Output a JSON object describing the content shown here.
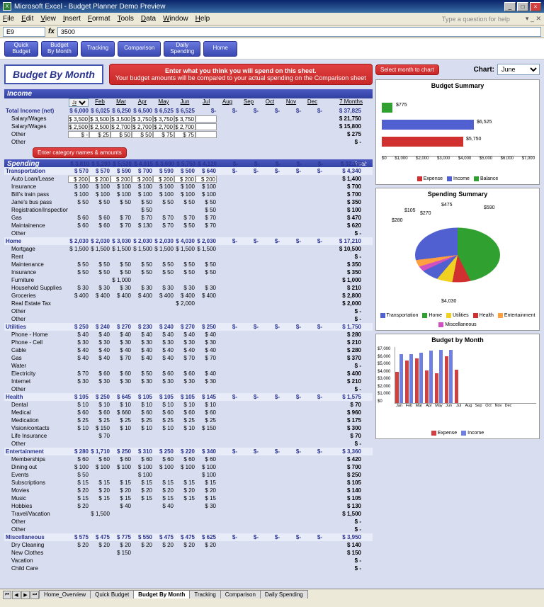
{
  "window": {
    "title": "Microsoft Excel - Budget Planner Demo Preview"
  },
  "menu": {
    "items": [
      "File",
      "Edit",
      "View",
      "Insert",
      "Format",
      "Tools",
      "Data",
      "Window",
      "Help"
    ],
    "help_prompt": "Type a question for help"
  },
  "formula": {
    "cellref": "E9",
    "value": "3500"
  },
  "nav": {
    "buttons": [
      "Quick Budget",
      "Budget By Month",
      "Tracking",
      "Comparison",
      "Daily Spending",
      "Home"
    ]
  },
  "header": {
    "page_title": "Budget By Month",
    "callout_line1": "Enter what you think you will spend on this sheet.",
    "callout_line2": "Your budget amounts will be compared to your actual spending on the Comparison sheet",
    "small_callout1": "Select month to chart",
    "small_callout2": "Enter category names & amounts",
    "chart_label": "Chart:",
    "chart_month": "June"
  },
  "months": [
    "Jan",
    "Feb",
    "Mar",
    "Apr",
    "May",
    "Jun",
    "Jul",
    "Aug",
    "Sep",
    "Oct",
    "Nov",
    "Dec"
  ],
  "total_col": "7 Months",
  "income": {
    "title": "Income",
    "net_label": "Total Income (net)",
    "net_row": [
      "$ 6,000",
      "$ 6,025",
      "$ 6,250",
      "$ 6,500",
      "$ 6,525",
      "$ 6,525",
      "$-",
      "$-",
      "$-",
      "$-",
      "$-",
      "$-"
    ],
    "net_total": "$ 37,825",
    "rows": [
      {
        "name": "Salary/Wages",
        "vals": [
          "$ 3,500",
          "$ 3,500",
          "$ 3,500",
          "$ 3,750",
          "$ 3,750",
          "$ 3,750"
        ],
        "tot": "21,750"
      },
      {
        "name": "Salary/Wages",
        "vals": [
          "$ 2,500",
          "$ 2,500",
          "$ 2,700",
          "$ 2,700",
          "$ 2,700",
          "$ 2,700"
        ],
        "tot": "15,800"
      },
      {
        "name": "Other",
        "vals": [
          "$  -",
          "$ 25",
          "$  50",
          "$  50",
          "$  75",
          "$  75"
        ],
        "tot": "275"
      },
      {
        "name": "Other",
        "vals": [],
        "tot": "-"
      }
    ]
  },
  "spending": {
    "title": "Spending",
    "total_label": "Total:",
    "totals": [
      "$ 3,810",
      "$ 5,280",
      "$ 5,520",
      "$ 4,015",
      "$ 3,690",
      "$ 5,750",
      "$ 4,120",
      "$-",
      "$-",
      "$-",
      "$-",
      "$-"
    ],
    "grand_total": "$ 32,185",
    "categories": [
      {
        "name": "Transportation",
        "totals": [
          "$ 570",
          "$ 570",
          "$ 590",
          "$ 700",
          "$ 590",
          "$ 500",
          "$ 640",
          "$-",
          "$-",
          "$-",
          "$-",
          "$-"
        ],
        "ct": "4,340",
        "rows": [
          {
            "name": "Auto Loan/Lease",
            "vals": [
              "$ 200",
              "$ 200",
              "$ 200",
              "$ 200",
              "$ 200",
              "$ 200",
              "$ 200"
            ],
            "tot": "1,400"
          },
          {
            "name": "Insurance",
            "vals": [
              "$ 100",
              "$ 100",
              "$ 100",
              "$ 100",
              "$ 100",
              "$ 100",
              "$ 100"
            ],
            "tot": "700"
          },
          {
            "name": "Bill's train pass",
            "vals": [
              "$ 100",
              "$ 100",
              "$ 100",
              "$ 100",
              "$ 100",
              "$ 100",
              "$ 100"
            ],
            "tot": "700"
          },
          {
            "name": "Jane's bus pass",
            "vals": [
              "$ 50",
              "$ 50",
              "$ 50",
              "$ 50",
              "$ 50",
              "$ 50",
              "$ 50"
            ],
            "tot": "350"
          },
          {
            "name": "Registration/Inspection",
            "vals": [
              "",
              "",
              "",
              "$ 50",
              "",
              "",
              "$ 50"
            ],
            "tot": "100"
          },
          {
            "name": "Gas",
            "vals": [
              "$ 60",
              "$ 60",
              "$ 70",
              "$ 70",
              "$ 70",
              "$ 70",
              "$ 70"
            ],
            "tot": "470"
          },
          {
            "name": "Maintainence",
            "vals": [
              "$ 60",
              "$ 60",
              "$ 70",
              "$ 130",
              "$ 70",
              "$ 50",
              "$ 70"
            ],
            "tot": "620"
          },
          {
            "name": "Other",
            "vals": [],
            "tot": "-"
          }
        ]
      },
      {
        "name": "Home",
        "totals": [
          "$ 2,030",
          "$ 2,030",
          "$ 3,030",
          "$ 2,030",
          "$ 2,030",
          "$ 4,030",
          "$ 2,030",
          "$-",
          "$-",
          "$-",
          "$-",
          "$-"
        ],
        "ct": "17,210",
        "rows": [
          {
            "name": "Mortgage",
            "vals": [
              "$ 1,500",
              "$ 1,500",
              "$ 1,500",
              "$ 1,500",
              "$ 1,500",
              "$ 1,500",
              "$ 1,500"
            ],
            "tot": "10,500"
          },
          {
            "name": "Rent",
            "vals": [],
            "tot": "-"
          },
          {
            "name": "Maintenance",
            "vals": [
              "$ 50",
              "$ 50",
              "$ 50",
              "$ 50",
              "$ 50",
              "$ 50",
              "$ 50"
            ],
            "tot": "350"
          },
          {
            "name": "Insurance",
            "vals": [
              "$ 50",
              "$ 50",
              "$ 50",
              "$ 50",
              "$ 50",
              "$ 50",
              "$ 50"
            ],
            "tot": "350"
          },
          {
            "name": "Furniture",
            "vals": [
              "",
              "",
              "$ 1,000",
              "",
              "",
              "",
              "",
              ""
            ],
            "tot": "1,000"
          },
          {
            "name": "Household Supplies",
            "vals": [
              "$ 30",
              "$ 30",
              "$ 30",
              "$ 30",
              "$ 30",
              "$ 30",
              "$ 30"
            ],
            "tot": "210"
          },
          {
            "name": "Groceries",
            "vals": [
              "$ 400",
              "$ 400",
              "$ 400",
              "$ 400",
              "$ 400",
              "$ 400",
              "$ 400"
            ],
            "tot": "2,800"
          },
          {
            "name": "Real Estate Tax",
            "vals": [
              "",
              "",
              "",
              "",
              "",
              "$ 2,000",
              ""
            ],
            "tot": "2,000"
          },
          {
            "name": "Other",
            "vals": [],
            "tot": "-"
          },
          {
            "name": "Other",
            "vals": [],
            "tot": "-"
          }
        ]
      },
      {
        "name": "Utilities",
        "totals": [
          "$ 250",
          "$ 240",
          "$ 270",
          "$ 230",
          "$ 240",
          "$ 270",
          "$ 250",
          "$-",
          "$-",
          "$-",
          "$-",
          "$-"
        ],
        "ct": "1,750",
        "rows": [
          {
            "name": "Phone - Home",
            "vals": [
              "$ 40",
              "$ 40",
              "$ 40",
              "$ 40",
              "$ 40",
              "$ 40",
              "$ 40"
            ],
            "tot": "280"
          },
          {
            "name": "Phone - Cell",
            "vals": [
              "$ 30",
              "$ 30",
              "$ 30",
              "$ 30",
              "$ 30",
              "$ 30",
              "$ 30"
            ],
            "tot": "210"
          },
          {
            "name": "Cable",
            "vals": [
              "$ 40",
              "$ 40",
              "$ 40",
              "$ 40",
              "$ 40",
              "$ 40",
              "$ 40"
            ],
            "tot": "280"
          },
          {
            "name": "Gas",
            "vals": [
              "$ 40",
              "$ 40",
              "$ 70",
              "$ 40",
              "$ 40",
              "$ 70",
              "$ 70"
            ],
            "tot": "370"
          },
          {
            "name": "Water",
            "vals": [],
            "tot": "-"
          },
          {
            "name": "Electricity",
            "vals": [
              "$ 70",
              "$ 60",
              "$ 60",
              "$ 50",
              "$ 60",
              "$ 60",
              "$ 40"
            ],
            "tot": "400"
          },
          {
            "name": "Internet",
            "vals": [
              "$ 30",
              "$ 30",
              "$ 30",
              "$ 30",
              "$ 30",
              "$ 30",
              "$ 30"
            ],
            "tot": "210"
          },
          {
            "name": "Other",
            "vals": [],
            "tot": "-"
          }
        ]
      },
      {
        "name": "Health",
        "totals": [
          "$ 105",
          "$ 250",
          "$ 645",
          "$ 105",
          "$ 105",
          "$ 105",
          "$ 145",
          "$-",
          "$-",
          "$-",
          "$-",
          "$-"
        ],
        "ct": "1,575",
        "rows": [
          {
            "name": "Dental",
            "vals": [
              "$ 10",
              "$ 10",
              "$ 10",
              "$ 10",
              "$ 10",
              "$ 10",
              "$ 10"
            ],
            "tot": "70"
          },
          {
            "name": "Medical",
            "vals": [
              "$ 60",
              "$ 60",
              "$ 660",
              "$ 60",
              "$ 60",
              "$ 60",
              "$ 60"
            ],
            "tot": "960"
          },
          {
            "name": "Medication",
            "vals": [
              "$ 25",
              "$ 25",
              "$ 25",
              "$ 25",
              "$ 25",
              "$ 25",
              "$ 25"
            ],
            "tot": "175"
          },
          {
            "name": "Vision/contacts",
            "vals": [
              "$ 10",
              "$ 150",
              "$ 10",
              "$ 10",
              "$ 10",
              "$ 10",
              "$ 150"
            ],
            "tot": "300"
          },
          {
            "name": "Life Insurance",
            "vals": [
              "",
              "$ 70",
              "",
              "",
              "",
              "",
              ""
            ],
            "tot": "70"
          },
          {
            "name": "Other",
            "vals": [],
            "tot": "-"
          }
        ]
      },
      {
        "name": "Entertainment",
        "totals": [
          "$ 280",
          "$ 1,710",
          "$ 250",
          "$ 310",
          "$ 250",
          "$ 220",
          "$ 340",
          "$-",
          "$-",
          "$-",
          "$-",
          "$-"
        ],
        "ct": "3,360",
        "rows": [
          {
            "name": "Memberships",
            "vals": [
              "$ 60",
              "$ 60",
              "$ 60",
              "$ 60",
              "$ 60",
              "$ 60",
              "$ 60"
            ],
            "tot": "420"
          },
          {
            "name": "Dining out",
            "vals": [
              "$ 100",
              "$ 100",
              "$ 100",
              "$ 100",
              "$ 100",
              "$ 100",
              "$ 100"
            ],
            "tot": "700"
          },
          {
            "name": "Events",
            "vals": [
              "$ 50",
              "",
              "",
              "$ 100",
              "",
              "",
              "$ 100"
            ],
            "tot": "250"
          },
          {
            "name": "Subscriptions",
            "vals": [
              "$ 15",
              "$ 15",
              "$ 15",
              "$ 15",
              "$ 15",
              "$ 15",
              "$ 15"
            ],
            "tot": "105"
          },
          {
            "name": "Movies",
            "vals": [
              "$ 20",
              "$ 20",
              "$ 20",
              "$ 20",
              "$ 20",
              "$ 20",
              "$ 20"
            ],
            "tot": "140"
          },
          {
            "name": "Music",
            "vals": [
              "$ 15",
              "$ 15",
              "$ 15",
              "$ 15",
              "$ 15",
              "$ 15",
              "$ 15"
            ],
            "tot": "105"
          },
          {
            "name": "Hobbies",
            "vals": [
              "$ 20",
              "",
              "$ 40",
              "",
              "$ 40",
              "",
              "$ 30"
            ],
            "tot": "130"
          },
          {
            "name": "Travel/Vacation",
            "vals": [
              "",
              "$ 1,500",
              "",
              "",
              "",
              "",
              ""
            ],
            "tot": "1,500"
          },
          {
            "name": "Other",
            "vals": [],
            "tot": "-"
          },
          {
            "name": "Other",
            "vals": [],
            "tot": "-"
          }
        ]
      },
      {
        "name": "Miscellaneous",
        "totals": [
          "$ 575",
          "$ 475",
          "$ 775",
          "$ 550",
          "$ 475",
          "$ 475",
          "$ 625",
          "$-",
          "$-",
          "$-",
          "$-",
          "$-"
        ],
        "ct": "3,950",
        "rows": [
          {
            "name": "Dry Cleaning",
            "vals": [
              "$ 20",
              "$ 20",
              "$ 20",
              "$ 20",
              "$ 20",
              "$ 20",
              "$ 20"
            ],
            "tot": "140"
          },
          {
            "name": "New Clothes",
            "vals": [
              "",
              "",
              "$ 150",
              "",
              "",
              "",
              ""
            ],
            "tot": "150"
          },
          {
            "name": "Vacation",
            "vals": [],
            "tot": "-"
          },
          {
            "name": "Child Care",
            "vals": [],
            "tot": "-"
          }
        ]
      }
    ]
  },
  "charts": {
    "summary": {
      "title": "Budget Summary",
      "labels": [
        "$775",
        "$6,525",
        "$5,750"
      ],
      "axis": [
        "$0",
        "$1,000",
        "$2,000",
        "$3,000",
        "$4,000",
        "$5,000",
        "$6,000",
        "$7,000"
      ],
      "legend": [
        "Expense",
        "Income",
        "Balance"
      ]
    },
    "pie": {
      "title": "Spending Summary",
      "labels": [
        "$280",
        "$105",
        "$270",
        "$475",
        "$590",
        "$4,030"
      ],
      "legend": [
        "Transportation",
        "Home",
        "Utilities",
        "Health",
        "Entertainment",
        "Miscellaneous"
      ]
    },
    "monthly": {
      "title": "Budget by Month",
      "ylabels": [
        "$7,000",
        "$6,000",
        "$5,000",
        "$4,000",
        "$3,000",
        "$2,000",
        "$1,000",
        "$0"
      ],
      "legend": [
        "Expense",
        "Income"
      ]
    }
  },
  "tabs": [
    "Home_Overview",
    "Quick Budget",
    "Budget By Month",
    "Tracking",
    "Comparison",
    "Daily Spending"
  ],
  "chart_data": [
    {
      "type": "bar",
      "title": "Budget Summary",
      "orientation": "horizontal",
      "categories": [
        "Balance",
        "Income",
        "Expense"
      ],
      "values": [
        775,
        6525,
        5750
      ],
      "colors": [
        "#30a030",
        "#5060d0",
        "#d03030"
      ],
      "xlim": [
        0,
        7000
      ],
      "xlabel": "",
      "ylabel": ""
    },
    {
      "type": "pie",
      "title": "Spending Summary",
      "series": [
        {
          "name": "Transportation",
          "value": 590
        },
        {
          "name": "Home",
          "value": 4030
        },
        {
          "name": "Utilities",
          "value": 270
        },
        {
          "name": "Health",
          "value": 105
        },
        {
          "name": "Entertainment",
          "value": 280
        },
        {
          "name": "Miscellaneous",
          "value": 475
        }
      ]
    },
    {
      "type": "bar",
      "title": "Budget by Month",
      "categories": [
        "Jan",
        "Feb",
        "Mar",
        "Apr",
        "May",
        "Jun",
        "Jul",
        "Aug",
        "Sep",
        "Oct",
        "Nov",
        "Dec"
      ],
      "series": [
        {
          "name": "Expense",
          "values": [
            3810,
            5280,
            5520,
            4015,
            3690,
            5750,
            4120,
            0,
            0,
            0,
            0,
            0
          ]
        },
        {
          "name": "Income",
          "values": [
            6000,
            6025,
            6250,
            6500,
            6525,
            6525,
            0,
            0,
            0,
            0,
            0,
            0
          ]
        }
      ],
      "ylim": [
        0,
        7000
      ],
      "ylabel": "$"
    }
  ]
}
